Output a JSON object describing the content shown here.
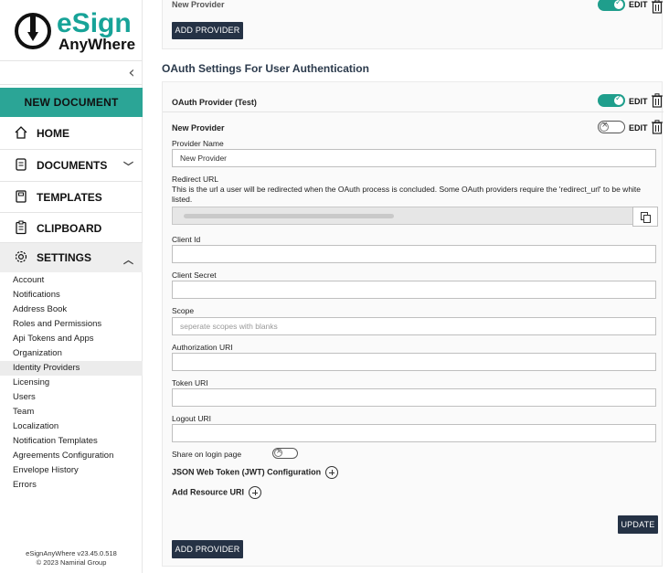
{
  "brand": {
    "title": "eSign",
    "subtitle": "AnyWhere",
    "accent": "#2ba596",
    "dark": "#253245"
  },
  "sidebar": {
    "collapse_icon": "chevron-left-icon",
    "new_document": "NEW DOCUMENT",
    "nav": [
      {
        "label": "HOME",
        "icon": "home-icon"
      },
      {
        "label": "DOCUMENTS",
        "icon": "document-icon"
      },
      {
        "label": "TEMPLATES",
        "icon": "template-icon"
      },
      {
        "label": "CLIPBOARD",
        "icon": "clipboard-icon"
      },
      {
        "label": "SETTINGS",
        "icon": "gear-icon"
      }
    ],
    "settings_items": [
      "Account",
      "Notifications",
      "Address Book",
      "Roles and Permissions",
      "Api Tokens and Apps",
      "Organization",
      "Identity Providers",
      "Licensing",
      "Users",
      "Team",
      "Localization",
      "Notification Templates",
      "Agreements Configuration",
      "Envelope History",
      "Errors"
    ],
    "selected_item": "Identity Providers",
    "version": "eSignAnyWhere v23.45.0.518",
    "copyright": "© 2023 Namirial Group"
  },
  "top_panel": {
    "cut_title": "New Provider",
    "edit_label": "EDIT",
    "add_provider": "ADD PROVIDER"
  },
  "oauth": {
    "section_title": "OAuth Settings For User Authentication",
    "provider_test": {
      "title": "OAuth Provider (Test)",
      "enabled": true,
      "edit_label": "EDIT"
    },
    "new_provider": {
      "title": "New Provider",
      "enabled": false,
      "edit_label": "EDIT",
      "fields": {
        "provider_name_label": "Provider Name",
        "provider_name_value": "New Provider",
        "redirect_url_label": "Redirect URL",
        "redirect_url_help": "This is the url a user will be redirected when the OAuth process is concluded. Some OAuth providers require the 'redirect_url' to be white listed.",
        "client_id_label": "Client Id",
        "client_id_value": "",
        "client_secret_label": "Client Secret",
        "client_secret_value": "",
        "scope_label": "Scope",
        "scope_placeholder": "seperate scopes with blanks",
        "authorization_uri_label": "Authorization URI",
        "authorization_uri_value": "",
        "token_uri_label": "Token URI",
        "token_uri_value": "",
        "logout_uri_label": "Logout URI",
        "logout_uri_value": "",
        "share_login_label": "Share on login page",
        "share_login_enabled": false,
        "jwt_label": "JSON Web Token (JWT) Configuration",
        "resource_uri_label": "Add Resource URI"
      },
      "update_button": "UPDATE"
    },
    "add_provider": "ADD PROVIDER"
  }
}
